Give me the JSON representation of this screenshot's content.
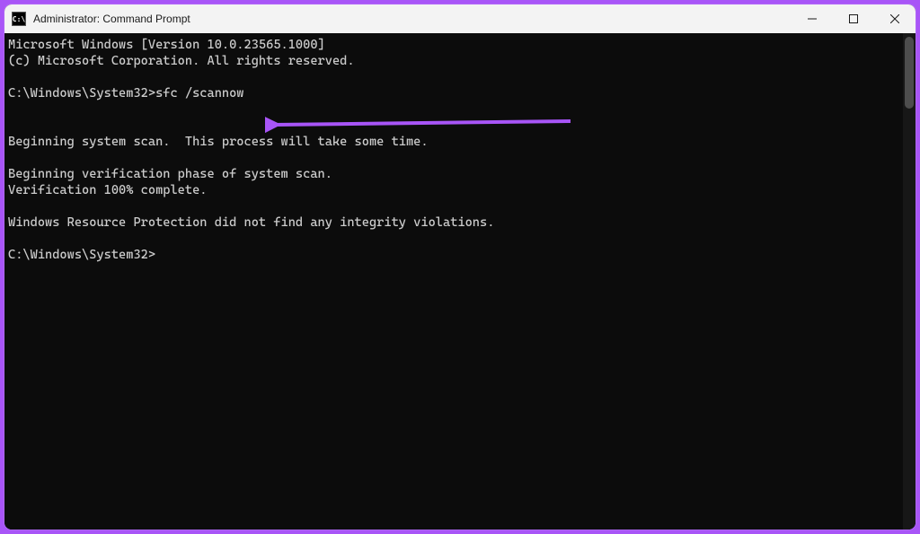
{
  "titlebar": {
    "icon_text": "C:\\",
    "title": "Administrator: Command Prompt"
  },
  "terminal": {
    "lines": [
      "Microsoft Windows [Version 10.0.23565.1000]",
      "(c) Microsoft Corporation. All rights reserved.",
      "",
      "C:\\Windows\\System32>sfc /scannow",
      "",
      "",
      "Beginning system scan.  This process will take some time.",
      "",
      "Beginning verification phase of system scan.",
      "Verification 100% complete.",
      "",
      "Windows Resource Protection did not find any integrity violations.",
      "",
      "C:\\Windows\\System32>"
    ]
  },
  "annotation": {
    "arrow_color": "#a855f7"
  }
}
